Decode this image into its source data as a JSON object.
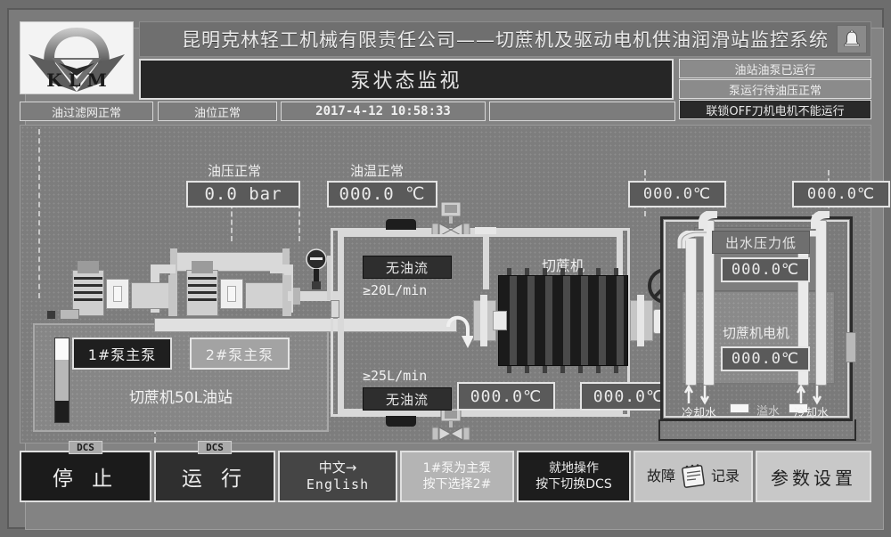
{
  "header": {
    "company_title": "昆明克林轻工机械有限责任公司——切蔗机及驱动电机供油润滑站监控系统",
    "logo_text": "K L M",
    "bell_icon": "bell-icon",
    "page_title": "泵状态监视",
    "status_right": [
      "油站油泵已运行",
      "泵运行待油压正常",
      "联锁OFF刀机电机不能运行"
    ]
  },
  "status_strip": {
    "filter": "油过滤网正常",
    "level": "油位正常",
    "datetime": "2017-4-12 10:58:33",
    "blank": ""
  },
  "diagram": {
    "oil_pressure_label": "油压正常",
    "oil_pressure_value": "0.0  bar",
    "oil_temp_label": "油温正常",
    "oil_temp_value": "000.0 ℃",
    "pump1": "1#泵主泵",
    "pump2": "2#泵主泵",
    "station_label": "切蔗机50L油站",
    "flow_top_status": "无油流",
    "flow_top_spec": "≥20L/min",
    "flow_bot_spec": "≥25L/min",
    "flow_bot_status": "无油流",
    "cutter_label": "切蔗机",
    "temp_cutter_left": "000.0℃",
    "temp_cutter_right": "000.0℃",
    "temp_top_mid": "000.0℃",
    "temp_top_right": "000.0℃",
    "water_pressure_label": "出水压力低",
    "water_temp_value": "000.0℃",
    "overflow_label": "溢水",
    "motor_label": "切蔗机电机",
    "motor_temp_value": "000.0℃",
    "cooling_left": "冷却水",
    "cooling_right": "冷却水"
  },
  "buttons": {
    "stop": {
      "tab": "DCS",
      "label": "停 止"
    },
    "run": {
      "tab": "DCS",
      "label": "运 行"
    },
    "lang": {
      "line1": "中文→",
      "line2": "English"
    },
    "pump_select": {
      "line1": "1#泵为主泵",
      "line2": "按下选择2#"
    },
    "dcs_switch": {
      "line1": "就地操作",
      "line2": "按下切换DCS"
    },
    "fault_log": {
      "left": "故障",
      "right": "记录",
      "icon": "notebook-icon"
    },
    "param": {
      "label": "参数设置"
    }
  },
  "colors": {
    "screen_bg": "#6d6d6d",
    "panel_bg": "#7d7d7d",
    "dark_box": "#2e2e2e",
    "text_light": "#ededed",
    "pipe": "#d9d9d9"
  }
}
